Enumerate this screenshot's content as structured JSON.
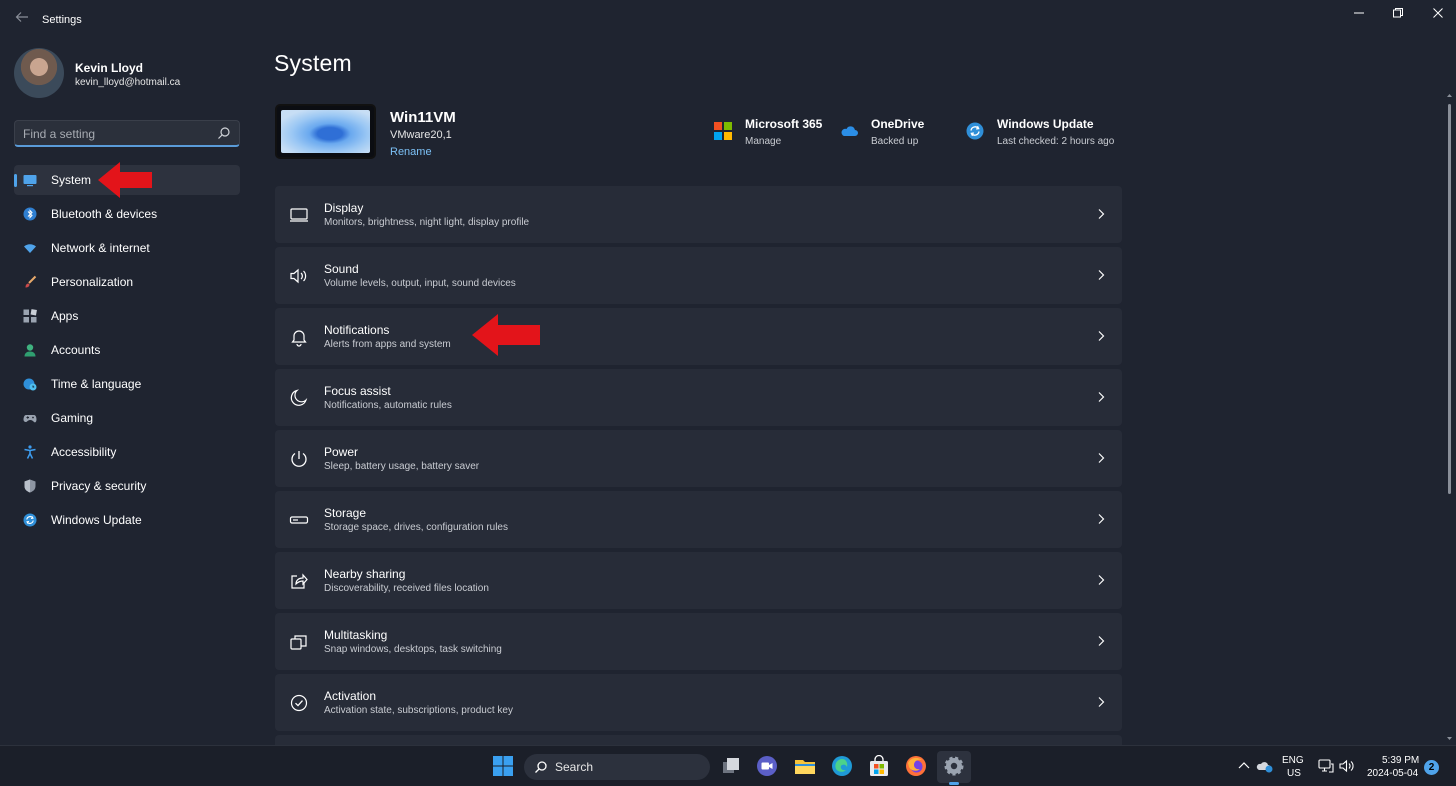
{
  "window": {
    "title": "Settings",
    "back_icon": "back-arrow-icon",
    "controls": [
      "minimize-icon",
      "restore-icon",
      "close-icon"
    ]
  },
  "profile": {
    "name": "Kevin Lloyd",
    "email": "kevin_lloyd@hotmail.ca"
  },
  "search": {
    "placeholder": "Find a setting"
  },
  "sidebar": {
    "items": [
      {
        "label": "System",
        "icon": "system-monitor-icon",
        "active": true
      },
      {
        "label": "Bluetooth & devices",
        "icon": "bluetooth-icon"
      },
      {
        "label": "Network & internet",
        "icon": "wifi-icon"
      },
      {
        "label": "Personalization",
        "icon": "brush-icon"
      },
      {
        "label": "Apps",
        "icon": "apps-icon"
      },
      {
        "label": "Accounts",
        "icon": "person-icon"
      },
      {
        "label": "Time & language",
        "icon": "globe-clock-icon"
      },
      {
        "label": "Gaming",
        "icon": "gamepad-icon"
      },
      {
        "label": "Accessibility",
        "icon": "accessibility-icon"
      },
      {
        "label": "Privacy & security",
        "icon": "shield-icon"
      },
      {
        "label": "Windows Update",
        "icon": "windows-update-icon"
      }
    ]
  },
  "main": {
    "title": "System",
    "device": {
      "name": "Win11VM",
      "model": "VMware20,1",
      "rename_link": "Rename"
    },
    "quick_links": [
      {
        "title": "Microsoft 365",
        "subtitle": "Manage",
        "icon": "microsoft-logo-icon"
      },
      {
        "title": "OneDrive",
        "subtitle": "Backed up",
        "icon": "onedrive-cloud-icon"
      },
      {
        "title": "Windows Update",
        "subtitle": "Last checked: 2 hours ago",
        "icon": "windows-update-icon"
      }
    ],
    "cards": [
      {
        "title": "Display",
        "subtitle": "Monitors, brightness, night light, display profile",
        "icon": "display-icon"
      },
      {
        "title": "Sound",
        "subtitle": "Volume levels, output, input, sound devices",
        "icon": "speaker-icon"
      },
      {
        "title": "Notifications",
        "subtitle": "Alerts from apps and system",
        "icon": "bell-icon"
      },
      {
        "title": "Focus assist",
        "subtitle": "Notifications, automatic rules",
        "icon": "moon-icon"
      },
      {
        "title": "Power",
        "subtitle": "Sleep, battery usage, battery saver",
        "icon": "power-icon"
      },
      {
        "title": "Storage",
        "subtitle": "Storage space, drives, configuration rules",
        "icon": "storage-drive-icon"
      },
      {
        "title": "Nearby sharing",
        "subtitle": "Discoverability, received files location",
        "icon": "share-icon"
      },
      {
        "title": "Multitasking",
        "subtitle": "Snap windows, desktops, task switching",
        "icon": "multitasking-icon"
      },
      {
        "title": "Activation",
        "subtitle": "Activation state, subscriptions, product key",
        "icon": "checkmark-circle-icon"
      }
    ]
  },
  "taskbar": {
    "search_label": "Search",
    "apps": [
      "start-icon",
      "task-view-icon",
      "meet-icon",
      "file-explorer-icon",
      "edge-icon",
      "store-icon",
      "firefox-icon",
      "settings-gear-icon"
    ],
    "language_line1": "ENG",
    "language_line2": "US",
    "time": "5:39 PM",
    "date": "2024-05-04",
    "notification_count": "2"
  },
  "colors": {
    "background": "#1f2430",
    "card": "#272c38",
    "accent": "#4fa3ea",
    "annotation_arrow": "#e3141a"
  }
}
